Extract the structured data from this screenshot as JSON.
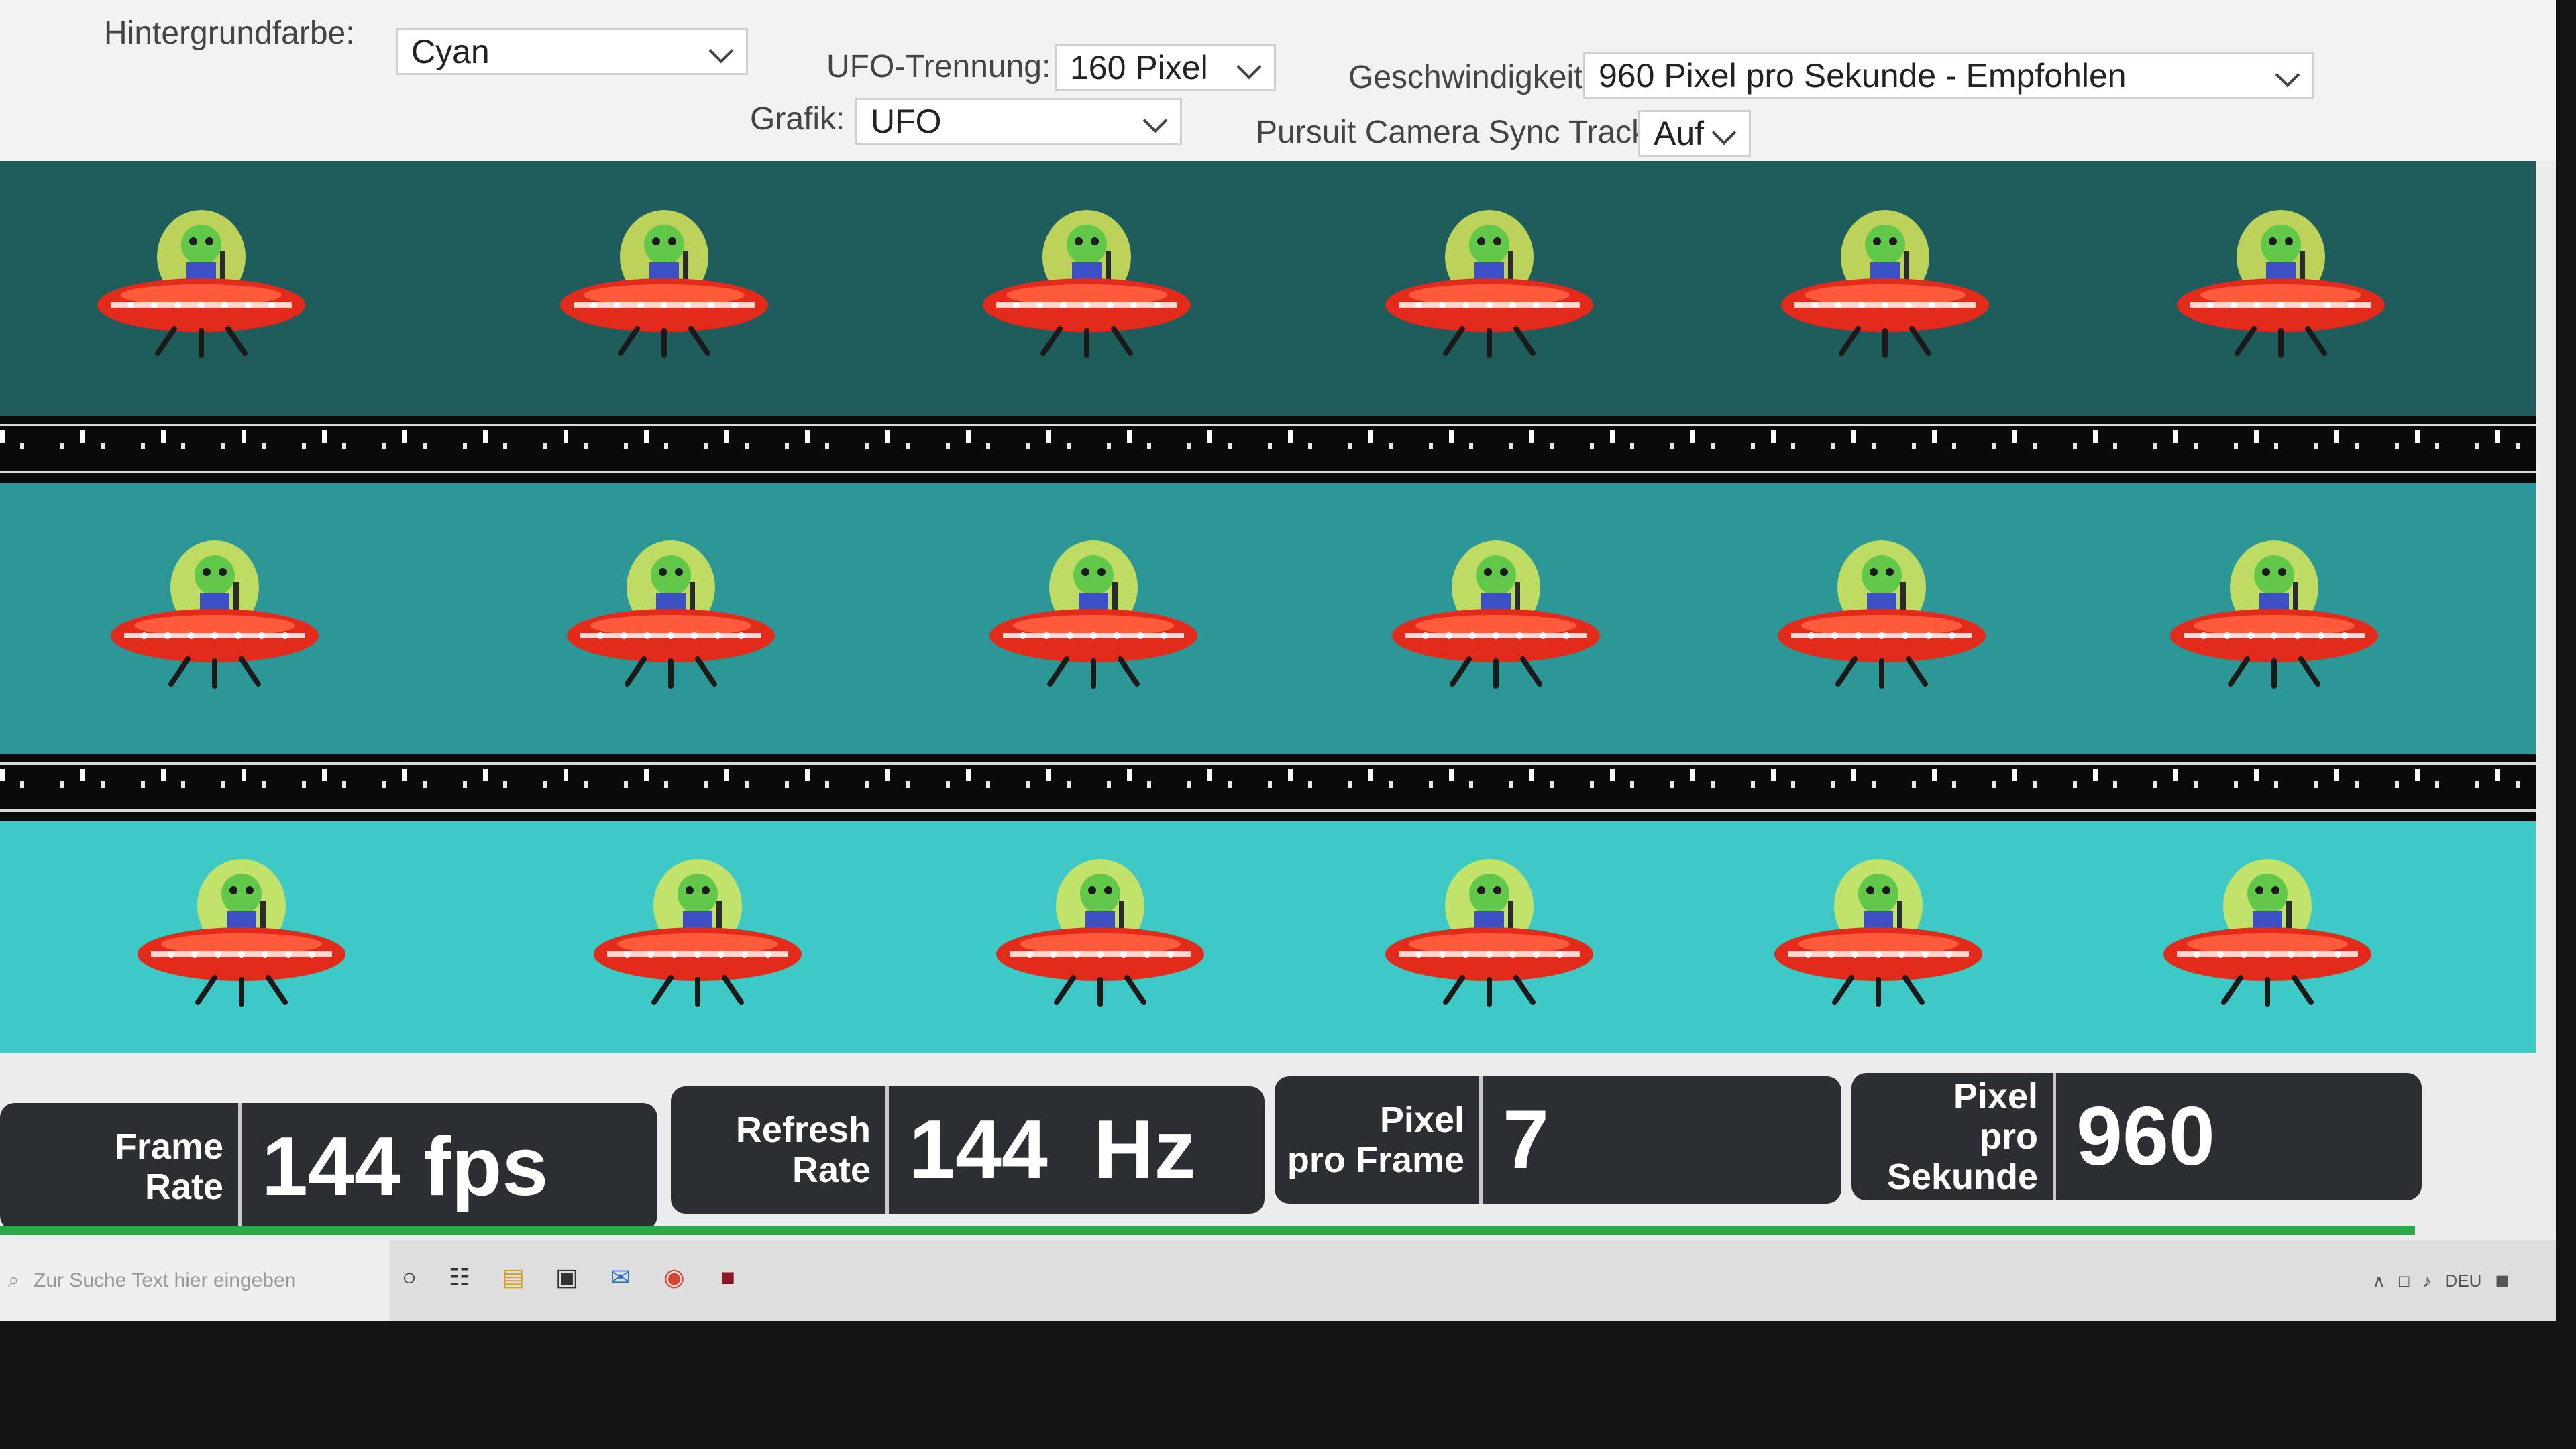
{
  "controls": {
    "background_color": {
      "label": "Hintergrundfarbe:",
      "value": "Cyan"
    },
    "ufo_separation": {
      "label": "UFO-Trennung:",
      "value": "160 Pixel"
    },
    "speed": {
      "label": "Geschwindigkeit:",
      "value": "960 Pixel pro Sekunde - Empfohlen"
    },
    "graphic": {
      "label": "Grafik:",
      "value": "UFO"
    },
    "sync_track": {
      "label": "Pursuit Camera Sync Track:",
      "value": "Auf"
    }
  },
  "lanes": [
    {
      "shade": "dark",
      "color": "#1f5c5c"
    },
    {
      "shade": "mid",
      "color": "#2d9797"
    },
    {
      "shade": "light",
      "color": "#3ec9c6"
    }
  ],
  "stats": {
    "frame_rate": {
      "label_line1": "Frame",
      "label_line2": "Rate",
      "value": "144 fps"
    },
    "refresh_rate": {
      "label_line1": "Refresh",
      "label_line2": "Rate",
      "value": "144  Hz"
    },
    "pixel_per_frame": {
      "label_line1": "Pixel",
      "label_line2": "pro Frame",
      "value": "7"
    },
    "pixel_per_second": {
      "label_line1": "Pixel",
      "label_line2": "pro",
      "label_line3": "Sekunde",
      "value": "960"
    }
  },
  "taskbar": {
    "search_placeholder": "Zur Suche Text hier eingeben",
    "language": "DEU"
  },
  "colors": {
    "ufo_saucer": "#e32b1c",
    "ufo_dome": "#d8e65a",
    "alien": "#62c84a",
    "stat_bg": "#2b2e33",
    "progress": "#2fa84a"
  }
}
